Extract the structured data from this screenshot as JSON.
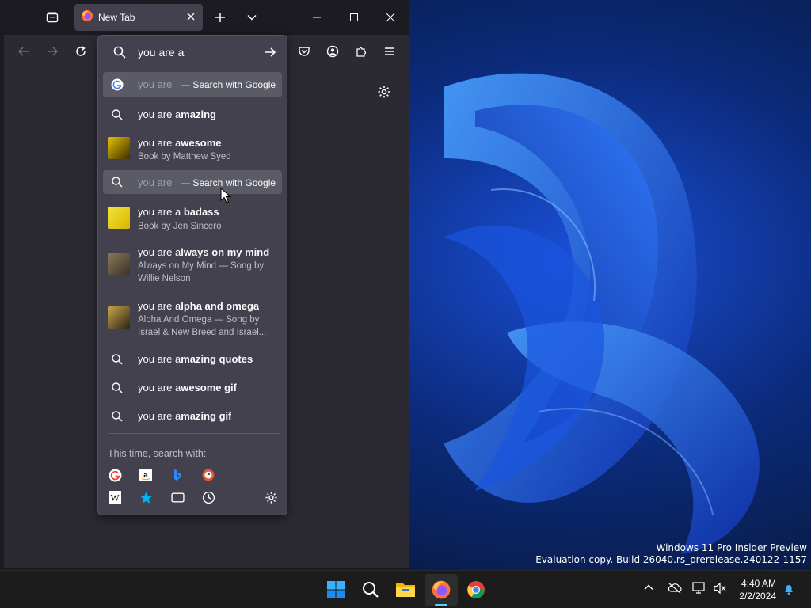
{
  "window": {
    "tab_title": "New Tab"
  },
  "urlbar": {
    "value": "you are a"
  },
  "suggestions": [
    {
      "type": "search-engine",
      "typed": "you are",
      "suffix": "— Search with Google"
    },
    {
      "type": "search",
      "typed": "you are a",
      "bold": "mazing"
    },
    {
      "type": "rich",
      "typed": "you are a",
      "bold": "wesome",
      "sub": "Book by Matthew Syed"
    },
    {
      "type": "search-engine",
      "typed": "you are",
      "suffix": "— Search with Google"
    },
    {
      "type": "rich",
      "typed": "you are a ",
      "bold": "badass",
      "sub": "Book by Jen Sincero"
    },
    {
      "type": "rich",
      "typed": "you are a",
      "bold": "lways on my mind",
      "sub": "Always on My Mind — Song by Willie Nelson"
    },
    {
      "type": "rich",
      "typed": "you are a",
      "bold": "lpha and omega",
      "sub": "Alpha And Omega — Song by Israel & New Breed and Israel..."
    },
    {
      "type": "search",
      "typed": "you are a",
      "bold": "mazing quotes"
    },
    {
      "type": "search",
      "typed": "you are a",
      "bold": "wesome gif"
    },
    {
      "type": "search",
      "typed": "you are a",
      "bold": "mazing gif"
    }
  ],
  "search_with": {
    "label": "This time, search with:",
    "engines": [
      "google-icon",
      "amazon-icon",
      "bing-icon",
      "duckduckgo-icon",
      "wikipedia-icon",
      "bookmarks-icon",
      "tabs-icon",
      "history-icon"
    ]
  },
  "watermark": {
    "line1": "Windows 11 Pro Insider Preview",
    "line2": "Evaluation copy. Build 26040.rs_prerelease.240122-1157"
  },
  "clock": {
    "time": "4:40 AM",
    "date": "2/2/2024"
  },
  "colors": {
    "accent": "#60cdff",
    "browser_bg": "#1c1b22",
    "toolbar_bg": "#2b2a33",
    "popup_bg": "#42414d"
  }
}
